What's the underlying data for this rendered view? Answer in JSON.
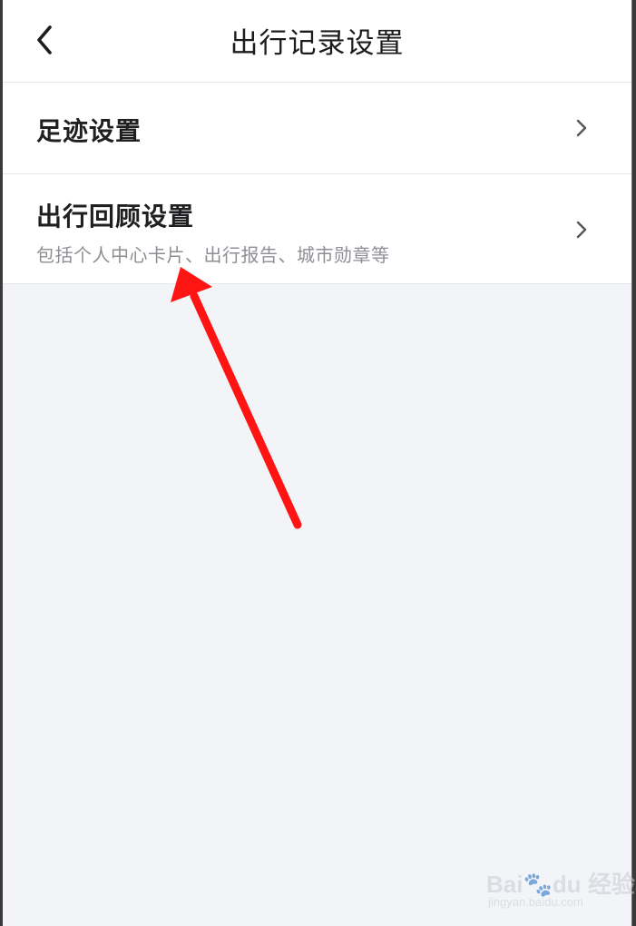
{
  "header": {
    "title": "出行记录设置",
    "back_icon": "chevron-left-icon"
  },
  "settings": {
    "items": [
      {
        "title": "足迹设置",
        "subtitle": "",
        "icon": "chevron-right-icon"
      },
      {
        "title": "出行回顾设置",
        "subtitle": "包括个人中心卡片、出行报告、城市勋章等",
        "icon": "chevron-right-icon"
      }
    ]
  },
  "annotation": {
    "color": "#ff1414",
    "icon": "red-arrow"
  },
  "watermark": {
    "logo": "Bai du 经验",
    "logo_prefix": "Bai",
    "logo_suffix": "du 经验",
    "url": "jingyan.baidu.com"
  },
  "colors": {
    "background": "#f3f4f8",
    "surface": "#ffffff",
    "title_text": "#1f1f21",
    "subtitle_text": "#8e8f94",
    "divider": "#e6e7eb"
  }
}
